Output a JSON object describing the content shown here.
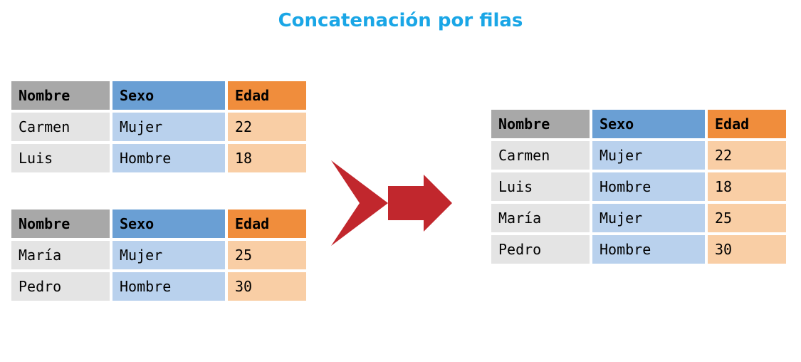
{
  "title": "Concatenación por filas",
  "columns": {
    "name": "Nombre",
    "sex": "Sexo",
    "age": "Edad"
  },
  "tableA": {
    "rows": [
      {
        "name": "Carmen",
        "sex": "Mujer",
        "age": 22
      },
      {
        "name": "Luis",
        "sex": "Hombre",
        "age": 18
      }
    ]
  },
  "tableB": {
    "rows": [
      {
        "name": "María",
        "sex": "Mujer",
        "age": 25
      },
      {
        "name": "Pedro",
        "sex": "Hombre",
        "age": 30
      }
    ]
  },
  "tableC": {
    "rows": [
      {
        "name": "Carmen",
        "sex": "Mujer",
        "age": 22
      },
      {
        "name": "Luis",
        "sex": "Hombre",
        "age": 18
      },
      {
        "name": "María",
        "sex": "Mujer",
        "age": 25
      },
      {
        "name": "Pedro",
        "sex": "Hombre",
        "age": 30
      }
    ]
  },
  "colors": {
    "title": "#1aa6e6",
    "arrow": "#c1272d",
    "header_name": "#a8a8a8",
    "header_sex": "#6a9fd4",
    "header_age": "#f08d3c",
    "cell_name": "#e4e4e4",
    "cell_sex": "#b9d1ed",
    "cell_age": "#f9cea5"
  }
}
